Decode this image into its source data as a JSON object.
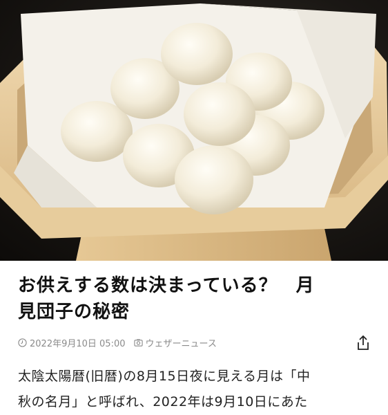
{
  "article": {
    "image": {
      "subject": "tsukimi-dango-photo"
    },
    "title_line1": "お供えする数は決まっている？　月",
    "title_line2": "見団子の秘密",
    "date": "2022年9月10日 05:00",
    "source": "ウェザーニュース",
    "body_line1": "太陰太陽暦(旧暦)の8月15日夜に見える月は「中",
    "body_line2": "秋の名月」と呼ばれ、2022年は9月10日にあた"
  },
  "icons": {
    "clock": "clock-icon",
    "source": "camera-icon",
    "share": "share-icon"
  },
  "colors": {
    "meta_text": "#8a8a8a",
    "title_text": "#111111",
    "body_text": "#222222"
  }
}
